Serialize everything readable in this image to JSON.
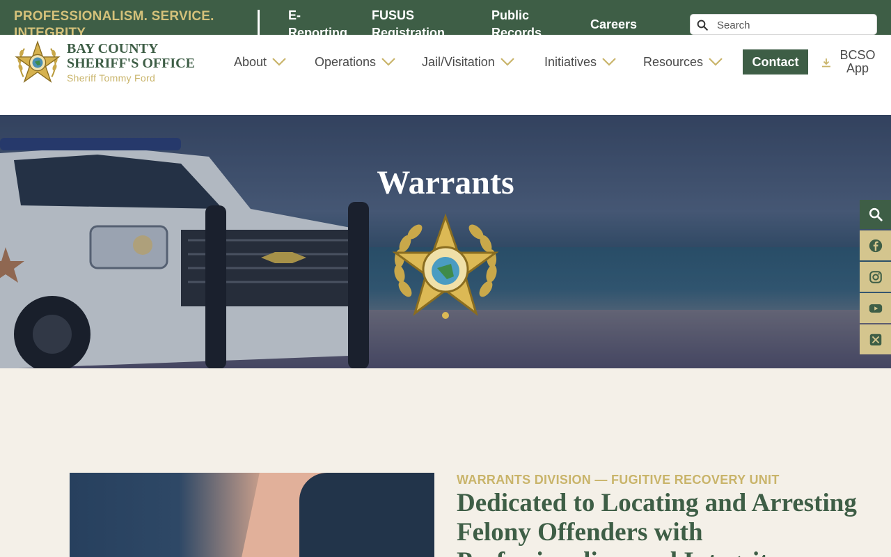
{
  "topbar": {
    "tagline": "PROFESSIONALISM. SERVICE. INTEGRITY.",
    "links": {
      "ereporting": "E-Reporting",
      "fusus": "FUSUS Registration",
      "records": "Public Records",
      "careers": "Careers"
    },
    "search_placeholder": "Search"
  },
  "logo": {
    "line1": "BAY COUNTY",
    "line2": "SHERIFF'S OFFICE",
    "sub": "Sheriff Tommy Ford"
  },
  "nav": {
    "about": "About",
    "operations": "Operations",
    "jail": "Jail/Visitation",
    "initiatives": "Initiatives",
    "resources": "Resources",
    "contact": "Contact",
    "app": "BCSO App"
  },
  "hero": {
    "title": "Warrants"
  },
  "social": [
    "search-icon",
    "facebook-icon",
    "instagram-icon",
    "youtube-icon",
    "x-icon"
  ],
  "content": {
    "eyebrow": "WARRANTS DIVISION — FUGITIVE RECOVERY UNIT",
    "title": "Dedicated to Locating and Arresting Felony Offenders with Professionalism and Integrity"
  },
  "colors": {
    "brand_green": "#3e5e46",
    "gold": "#c9b46a",
    "social_bg": "#d4c58e",
    "page_bg": "#f4f0e8"
  }
}
